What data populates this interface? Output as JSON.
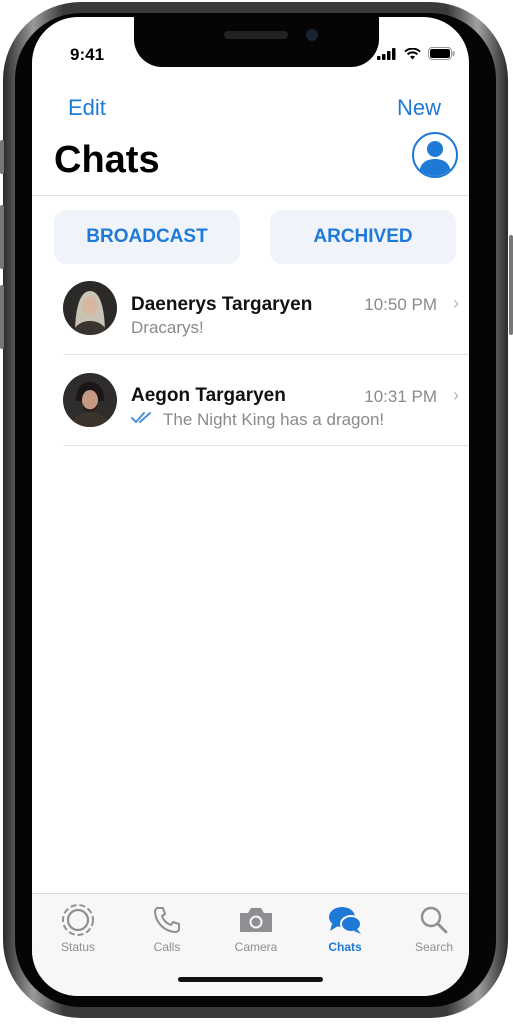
{
  "status_bar": {
    "time": "9:41"
  },
  "nav": {
    "edit_label": "Edit",
    "new_label": "New",
    "title": "Chats",
    "profile_icon": "person-circle-icon"
  },
  "segments": {
    "broadcast_label": "BROADCAST",
    "archived_label": "ARCHIVED"
  },
  "chats": [
    {
      "name": "Daenerys Targaryen",
      "time": "10:50 PM",
      "message": "Dracarys!"
    },
    {
      "name": "Aegon Targaryen",
      "time": "10:31 PM",
      "message": "The Night King has a dragon!",
      "read_receipt": "double-check-icon"
    }
  ],
  "tabs": [
    {
      "label": "Status",
      "icon": "status-icon"
    },
    {
      "label": "Calls",
      "icon": "phone-icon"
    },
    {
      "label": "Camera",
      "icon": "camera-icon"
    },
    {
      "label": "Chats",
      "icon": "chat-bubbles-icon",
      "active": true
    },
    {
      "label": "Search",
      "icon": "search-icon"
    }
  ],
  "colors": {
    "accent": "#1e7ad6",
    "secondary_text": "#8a8a8a",
    "segment_bg": "#f0f4fa"
  }
}
